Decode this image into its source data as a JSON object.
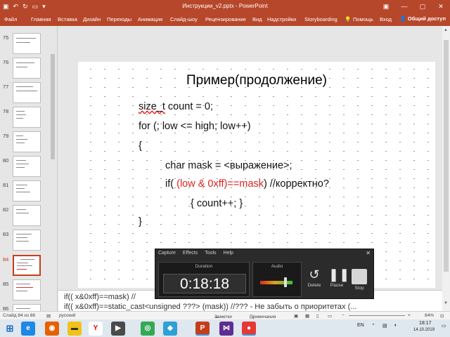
{
  "titlebar": {
    "title": "Инструкции_v2.pptx - PowerPoint",
    "bg_color": "#b7472a"
  },
  "ribbon": {
    "tabs": [
      "Файл",
      "Главная",
      "Вставка",
      "Дизайн",
      "Переходы",
      "Анимация",
      "Слайд-шоу",
      "Рецензирование",
      "Вид",
      "Надстройки",
      "Storyboarding"
    ],
    "help": "Помощь",
    "signin": "Вход",
    "share": "Общий доступ"
  },
  "thumbnails": [
    {
      "num": "75",
      "active": false
    },
    {
      "num": "76",
      "active": false
    },
    {
      "num": "77",
      "active": false
    },
    {
      "num": "78",
      "active": false
    },
    {
      "num": "79",
      "active": false
    },
    {
      "num": "80",
      "active": false
    },
    {
      "num": "81",
      "active": false
    },
    {
      "num": "82",
      "active": false
    },
    {
      "num": "83",
      "active": false
    },
    {
      "num": "84",
      "active": true
    },
    {
      "num": "85",
      "active": false
    },
    {
      "num": "86",
      "active": false
    }
  ],
  "slide": {
    "title": "Пример(продолжение)",
    "line1_a": "size_t",
    "line1_b": " count = 0;",
    "line2": "for (; low <= high; low++)",
    "line3": "{",
    "line4": "char mask = <выражение>;",
    "line5_a": "if( ",
    "line5_b": "(low & 0xff)==mask",
    "line5_c": ")  //корректно?",
    "line6": "{ count++;  }",
    "line7": "}"
  },
  "notes": {
    "line1": "if(( x&0xff)==mask) //",
    "line2": "if(( x&0xff)==static_cast<unsigned ???> (mask)) //??? - Не забыть о приоритетах (..."
  },
  "statusbar": {
    "slide_info": "Слайд 84 из 88",
    "language": "русский",
    "notes_btn": "Заметки",
    "comments_btn": "Примечания",
    "zoom": "84%"
  },
  "recorder": {
    "menu": [
      "Capture",
      "Effects",
      "Tools",
      "Help"
    ],
    "close": "✕",
    "duration_label": "Duration",
    "duration_value": "0:18:18",
    "audio_label": "Audio",
    "audio_level": 0.78,
    "delete_label": "Delete",
    "pause_label": "Pause",
    "stop_label": "Stop"
  },
  "taskbar": {
    "lang": "EN",
    "time": "18:17",
    "date": "14.10.2019"
  }
}
